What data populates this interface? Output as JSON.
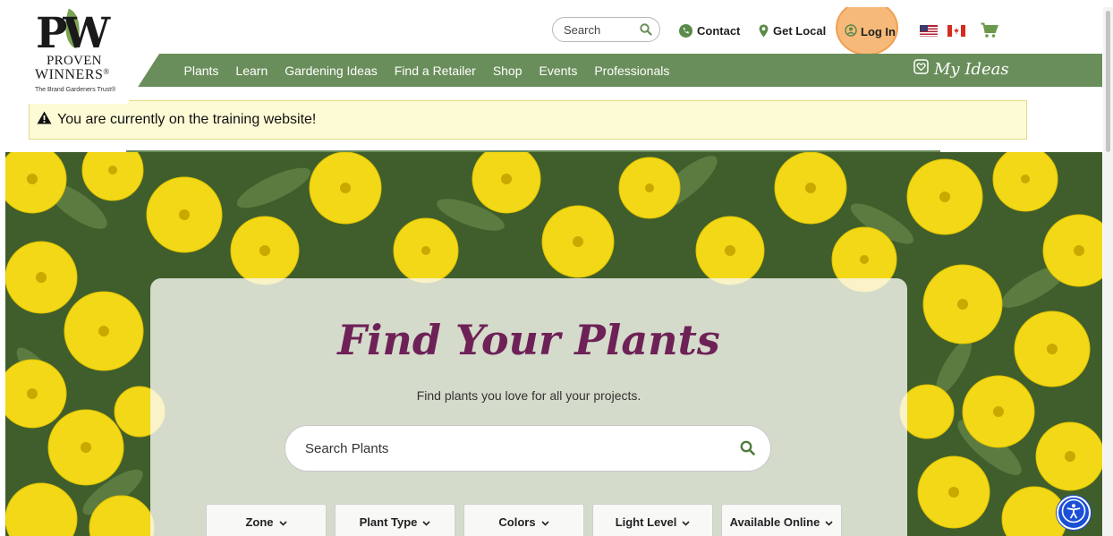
{
  "brand": {
    "logo_monogram": "PW",
    "logo_line1": "PROVEN",
    "logo_line2": "WINNERS",
    "logo_registered": "®",
    "logo_tagline": "The Brand Gardeners Trust®",
    "primary_green": "#6a8e5b",
    "accent_purple": "#6e2157"
  },
  "topbar": {
    "search_placeholder": "Search",
    "contact_label": "Contact",
    "get_local_label": "Get Local",
    "login_label": "Log In",
    "highlight_color": "#f5a95c",
    "flags": [
      "us-flag-icon",
      "canada-flag-icon"
    ]
  },
  "nav": {
    "items": [
      "Plants",
      "Learn",
      "Gardening Ideas",
      "Find a Retailer",
      "Shop",
      "Events",
      "Professionals"
    ],
    "my_ideas_label": "My Ideas"
  },
  "notice": {
    "text": "You are currently on the training website!",
    "icon": "warning-icon"
  },
  "finder": {
    "title": "Find Your Plants",
    "subtitle": "Find plants you love for all your projects.",
    "search_placeholder": "Search Plants",
    "filters": [
      {
        "label": "Zone"
      },
      {
        "label": "Plant Type"
      },
      {
        "label": "Colors"
      },
      {
        "label": "Light Level"
      },
      {
        "label": "Available Online"
      }
    ]
  }
}
